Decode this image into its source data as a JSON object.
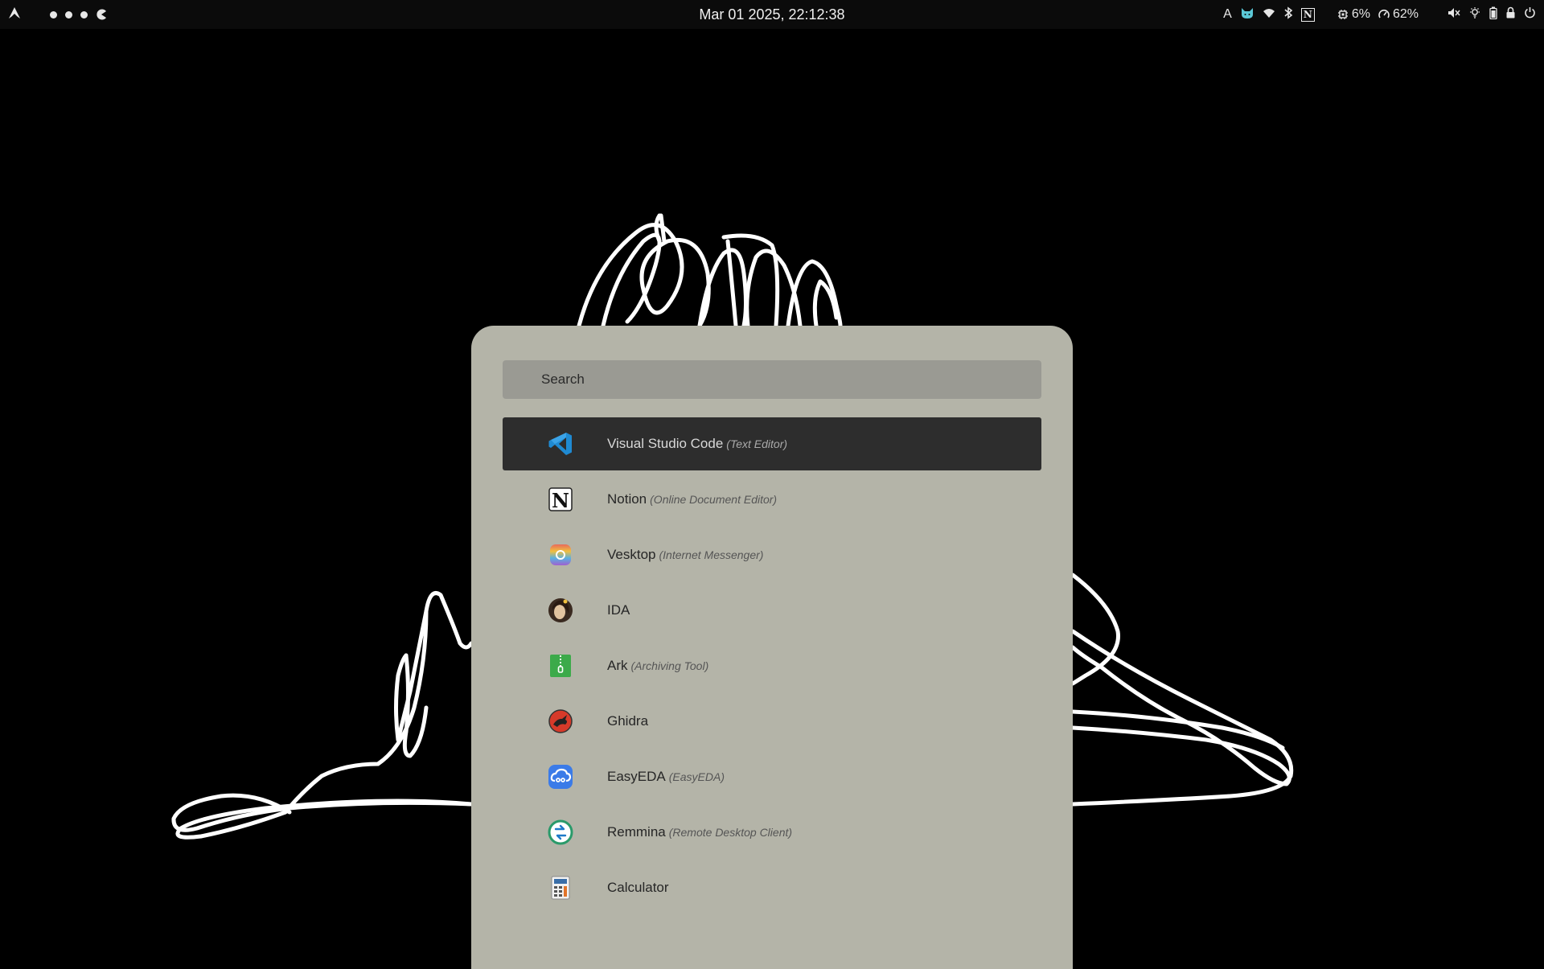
{
  "topbar": {
    "clock": "Mar 01 2025, 22:12:38",
    "workspaces": [
      "workspace-1",
      "workspace-2",
      "workspace-3",
      "workspace-4"
    ],
    "tray": {
      "keyboard_layout": "A",
      "cpu_usage": "6%",
      "memory_usage": "62%"
    }
  },
  "launcher": {
    "search_placeholder": "Search",
    "items": [
      {
        "name": "Visual Studio Code",
        "description": "(Text Editor)",
        "icon": "vscode-icon",
        "selected": true
      },
      {
        "name": "Notion",
        "description": "(Online Document Editor)",
        "icon": "notion-icon"
      },
      {
        "name": "Vesktop",
        "description": "(Internet Messenger)",
        "icon": "vesktop-icon"
      },
      {
        "name": "IDA",
        "description": "",
        "icon": "ida-icon"
      },
      {
        "name": "Ark",
        "description": "(Archiving Tool)",
        "icon": "ark-icon"
      },
      {
        "name": "Ghidra",
        "description": "",
        "icon": "ghidra-icon"
      },
      {
        "name": "EasyEDA",
        "description": "(EasyEDA)",
        "icon": "easyeda-icon"
      },
      {
        "name": "Remmina",
        "description": "(Remote Desktop Client)",
        "icon": "remmina-icon"
      },
      {
        "name": "Calculator",
        "description": "",
        "icon": "calculator-icon"
      }
    ]
  },
  "colors": {
    "topbar_bg": "#0b0b0b",
    "launcher_bg": "#b4b4a8",
    "search_bg": "#9a9a93",
    "selected_bg": "#2d2d2d",
    "wallpaper_bg": "#000000"
  }
}
